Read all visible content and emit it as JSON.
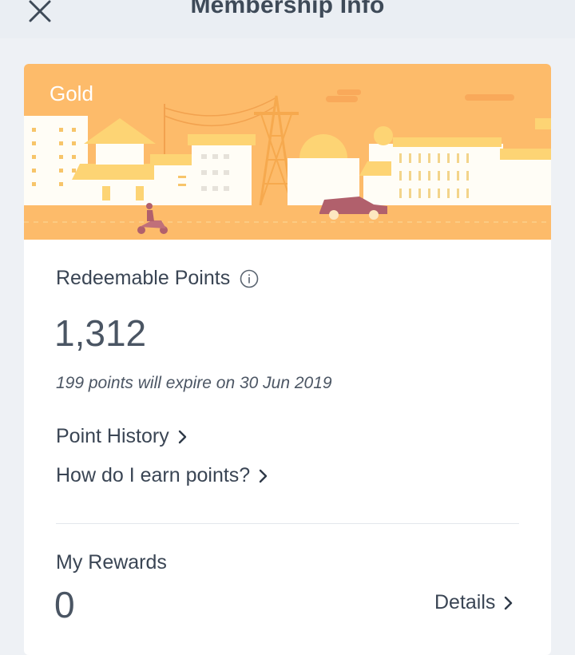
{
  "header": {
    "title": "Membership Info",
    "close_icon": "close-icon"
  },
  "membership": {
    "tier": "Gold",
    "banner_color": "#fdb867"
  },
  "points": {
    "title": "Redeemable Points",
    "info_icon": "info-icon",
    "value": "1,312",
    "expiry_note": "199 points will expire on 30 Jun 2019"
  },
  "links": {
    "point_history": "Point History",
    "earn_points": "How do I earn points?"
  },
  "rewards": {
    "title": "My Rewards",
    "value": "0",
    "details_label": "Details"
  }
}
